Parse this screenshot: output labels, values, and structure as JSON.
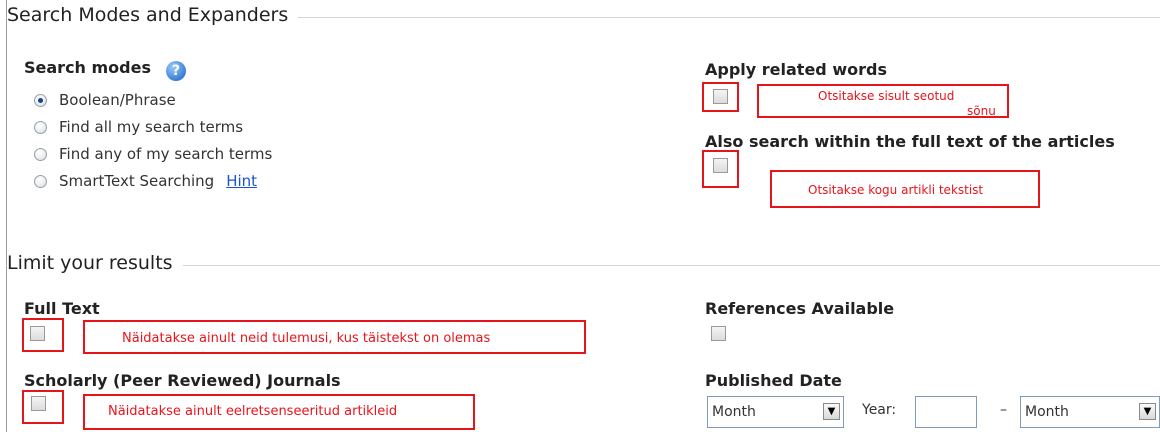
{
  "search_modes_section": {
    "title": "Search Modes and Expanders",
    "modes_label": "Search modes",
    "help_icon": "?",
    "modes": [
      {
        "label": "Boolean/Phrase",
        "checked": true
      },
      {
        "label": "Find all my search terms",
        "checked": false
      },
      {
        "label": "Find any of my search terms",
        "checked": false
      },
      {
        "label": "SmartText Searching",
        "checked": false
      }
    ],
    "hint_link": "Hint",
    "apply_related_label": "Apply related words",
    "apply_related_note_line1": "Otsitakse sisult seotud",
    "apply_related_note_line2": "sõnu",
    "full_text_search_label": "Also search within the full text of the articles",
    "full_text_search_note": "Otsitakse kogu artikli tekstist"
  },
  "limit_section": {
    "title": "Limit your results",
    "full_text_label": "Full Text",
    "full_text_note": "Näidatakse ainult neid tulemusi, kus täistekst on olemas",
    "scholarly_label": "Scholarly (Peer Reviewed) Journals",
    "scholarly_note": "Näidatakse ainult eelretsenseeritud artikleid",
    "references_label": "References Available",
    "published_date_label": "Published Date",
    "month_from": "Month",
    "year_label": "Year:",
    "year_value": "",
    "dash": "–",
    "month_to": "Month"
  },
  "colors": {
    "annotation_red": "#e8141c",
    "link_blue": "#1a56c8"
  }
}
